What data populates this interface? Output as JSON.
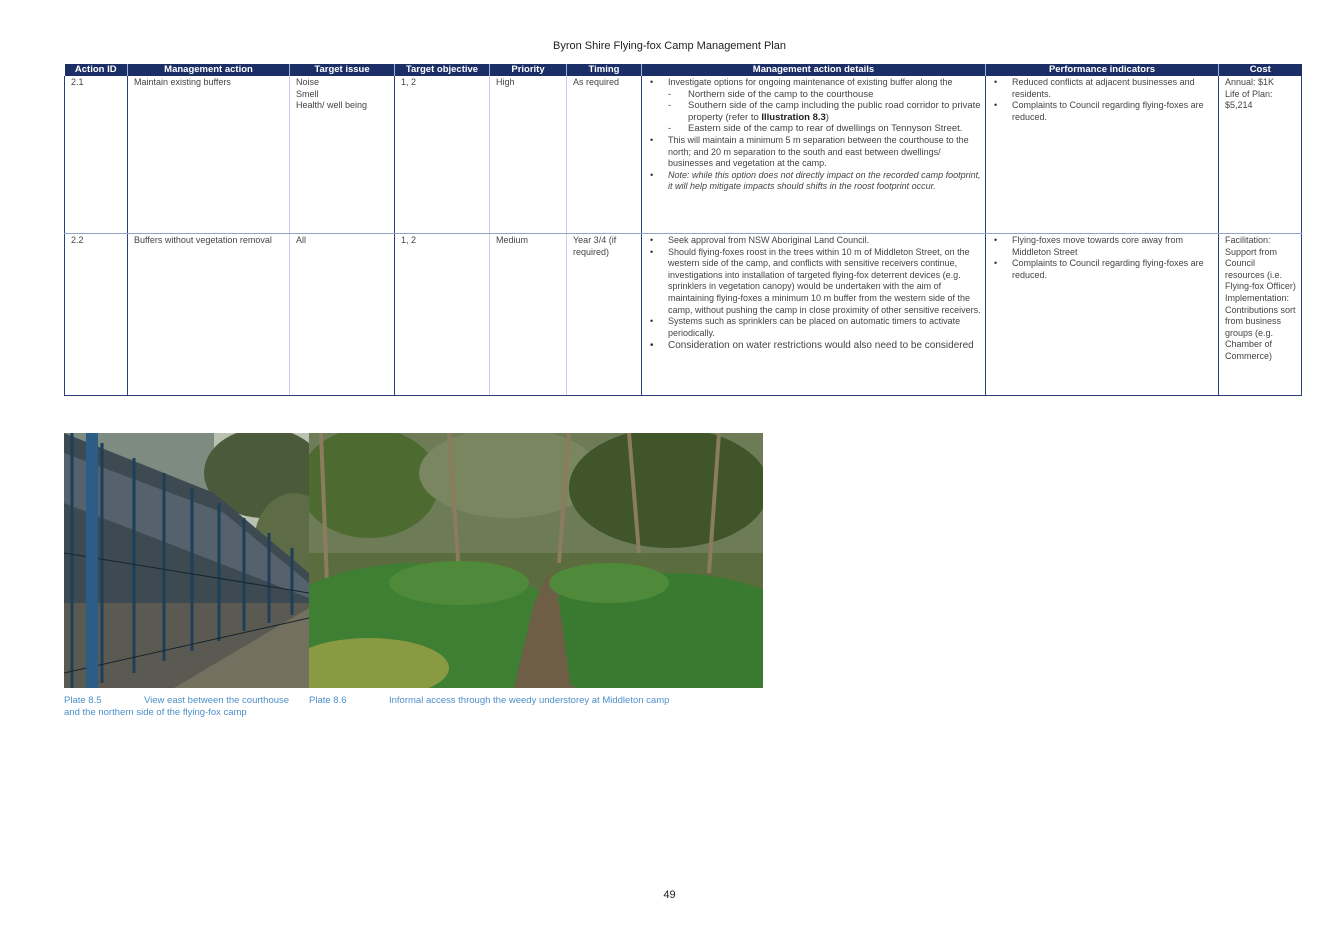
{
  "document": {
    "title": "Byron Shire Flying-fox Camp Management Plan",
    "page_number": "49"
  },
  "table": {
    "headers": [
      "Action ID",
      "Management action",
      "Target issue",
      "Target objective",
      "Priority",
      "Timing",
      "Management action details",
      "Performance indicators",
      "Cost"
    ],
    "rows": [
      {
        "action_id": "2.1",
        "management_action": "Maintain existing buffers",
        "target_issue": [
          "Noise",
          "Smell",
          "Health/ well being"
        ],
        "target_objective": "1, 2",
        "priority": "High",
        "timing": "As required",
        "details": {
          "b1": "Investigate options for ongoing maintenance of existing buffer along the",
          "sub1": "Northern side of the camp to the courthouse",
          "sub2_pre": "Southern side of the camp including the public road corridor to private property (refer to ",
          "sub2_bold": "Illustration 8.3",
          "sub2_post": ")",
          "sub3": "Eastern side of the camp to rear of dwellings on Tennyson Street.",
          "b2": "This will maintain a minimum 5 m separation between the courthouse to the north; and 20 m separation to the south and east between dwellings/ businesses and vegetation at the camp.",
          "b3": "Note: while this option does not directly impact on the recorded camp footprint, it will help mitigate impacts should shifts in the roost footprint occur."
        },
        "performance": [
          "Reduced conflicts at adjacent businesses and residents.",
          "Complaints to Council regarding flying-foxes are reduced."
        ],
        "cost": [
          "Annual: $1K",
          "Life of Plan: $5,214"
        ]
      },
      {
        "action_id": "2.2",
        "management_action": "Buffers without vegetation removal",
        "target_issue": [
          "All"
        ],
        "target_objective": "1, 2",
        "priority": "Medium",
        "timing": "Year 3/4 (if required)",
        "details": {
          "b1": "Seek approval from NSW Aboriginal Land Council.",
          "b2": "Should flying-foxes roost in the trees within 10 m of Middleton Street, on the western side of the camp, and conflicts with sensitive receivers continue, investigations into installation of targeted flying-fox deterrent devices (e.g. sprinklers in vegetation canopy) would be undertaken with the aim of maintaining flying-foxes a minimum 10 m buffer from the western side of the camp, without pushing the camp in close proximity of other sensitive receivers.",
          "b3": "Systems such as sprinklers can be placed on automatic timers to activate periodically.",
          "b4": "Consideration on water restrictions would also need to be considered"
        },
        "performance": [
          "Flying-foxes move towards core away from Middleton Street",
          "Complaints to Council regarding flying-foxes are reduced."
        ],
        "cost": [
          "Facilitation: Support from Council resources (i.e. Flying-fox Officer)",
          "Implementation:",
          "Contributions sort from business groups (e.g. Chamber of Commerce)"
        ]
      }
    ]
  },
  "plates": [
    {
      "number": "Plate 8.5",
      "caption": "View east between the courthouse and the northern side of the flying-fox camp"
    },
    {
      "number": "Plate 8.6",
      "caption": "Informal access through the weedy understorey at Middleton camp"
    }
  ]
}
